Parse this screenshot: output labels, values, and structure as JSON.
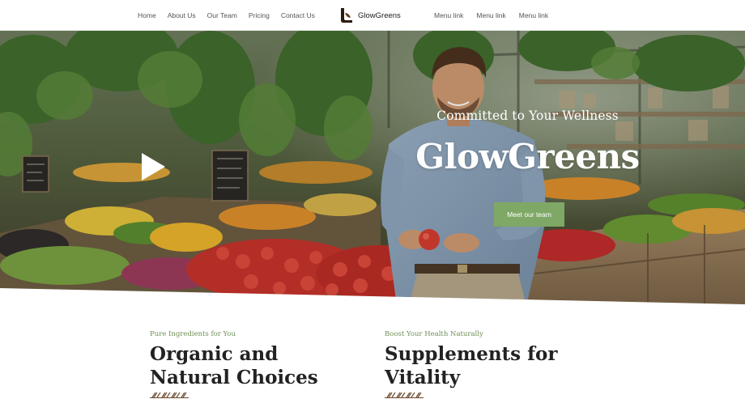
{
  "header": {
    "nav_left": [
      {
        "label": "Home"
      },
      {
        "label": "About Us"
      },
      {
        "label": "Our Team"
      },
      {
        "label": "Pricing"
      },
      {
        "label": "Contact Us"
      }
    ],
    "logo_text": "GlowGreens",
    "nav_right": [
      {
        "label": "Menu link"
      },
      {
        "label": "Menu link"
      },
      {
        "label": "Menu link"
      }
    ]
  },
  "hero": {
    "subtitle": "Committed to Your Wellness",
    "title": "GlowGreens",
    "cta_label": "Meet our team",
    "play_icon": "play-icon"
  },
  "features": [
    {
      "kicker": "Pure Ingredients for You",
      "title": "Organic and Natural Choices"
    },
    {
      "kicker": "Boost Your Health Naturally",
      "title": "Supplements for Vitality"
    }
  ],
  "colors": {
    "accent_green": "#7fa866",
    "kicker_green": "#6e8f55",
    "text_dark": "#222222",
    "divider_brown": "#6b4a2e"
  }
}
